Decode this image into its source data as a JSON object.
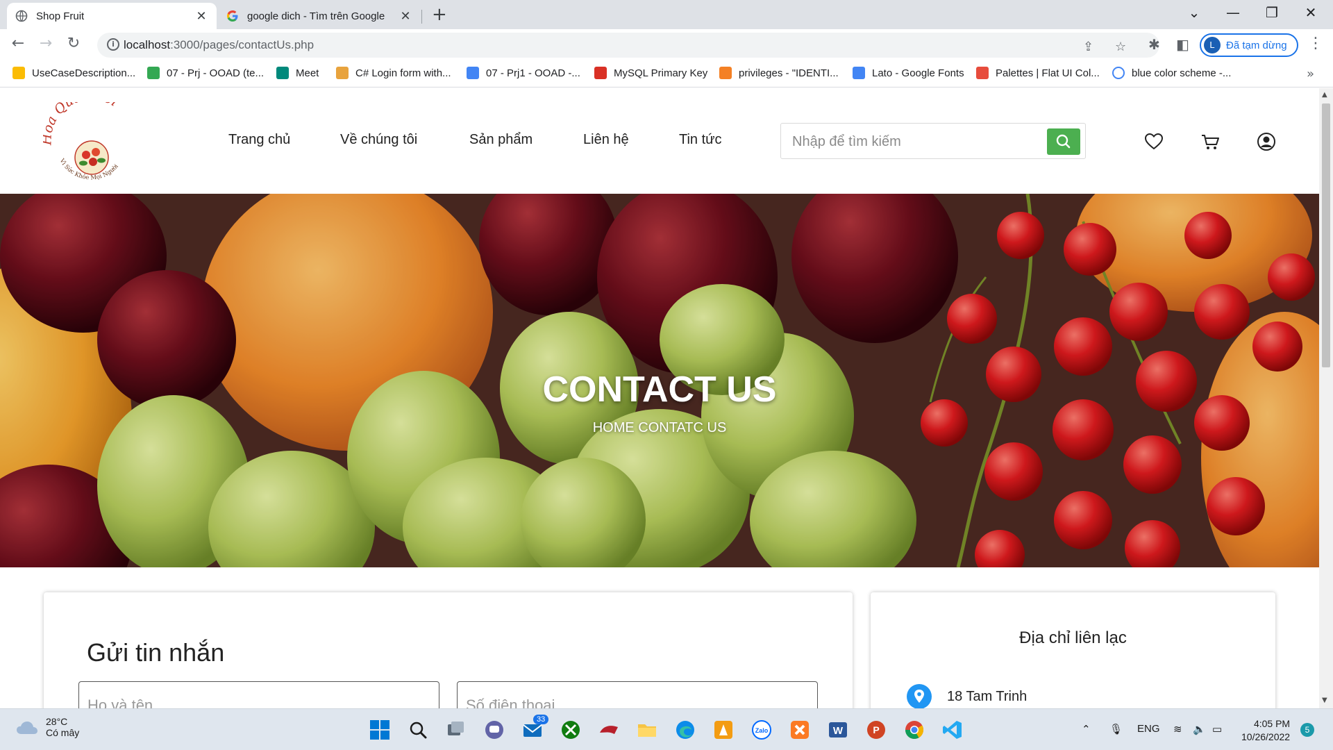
{
  "browser": {
    "tabs": [
      {
        "title": "Shop Fruit",
        "close": "✕"
      },
      {
        "title": "google dich - Tìm trên Google",
        "close": "✕"
      }
    ],
    "new_tab": "+",
    "address": {
      "host": "localhost",
      "path": ":3000/pages/contactUs.php"
    },
    "profile": {
      "initial": "L",
      "label": "Đã tạm dừng"
    },
    "bookmarks": [
      {
        "label": "UseCaseDescription...",
        "icon": "google-drive-icon",
        "color": "#fbbc04"
      },
      {
        "label": "07 - Prj - OOAD (te...",
        "icon": "google-drive-icon",
        "color": "#34a853"
      },
      {
        "label": "Meet",
        "icon": "google-meet-icon",
        "color": "#00897b"
      },
      {
        "label": "C# Login form with...",
        "icon": "page-icon",
        "color": "#e8a33d"
      },
      {
        "label": "07 - Prj1 - OOAD -...",
        "icon": "google-drive-icon",
        "color": "#4285f4"
      },
      {
        "label": "MySQL Primary Key",
        "icon": "mysql-icon",
        "color": "#d93025"
      },
      {
        "label": "privileges - \"IDENTI...",
        "icon": "stackoverflow-icon",
        "color": "#f48024"
      },
      {
        "label": "Lato - Google Fonts",
        "icon": "google-fonts-icon",
        "color": "#4285f4"
      },
      {
        "label": "Palettes | Flat UI Col...",
        "icon": "flatui-icon",
        "color": "#e74c3c"
      },
      {
        "label": "blue color scheme -...",
        "icon": "google-icon",
        "color": "#4285f4"
      }
    ],
    "bookmarks_more": "»"
  },
  "site": {
    "logo_alt": "Hoa Quả Tươi",
    "logo_line1": "Hoa Quả Tươi",
    "logo_line2": "Vì Sức Khỏe Mọi Người",
    "nav": [
      "Trang chủ",
      "Về chúng tôi",
      "Sản phẩm",
      "Liên hệ",
      "Tin tức"
    ],
    "search_placeholder": "Nhập để tìm kiếm",
    "icons": [
      "heart-icon",
      "cart-icon",
      "user-icon"
    ]
  },
  "hero": {
    "title": "CONTACT US",
    "breadcrumb": "HOME CONTATC US"
  },
  "message_card": {
    "title": "Gửi tin nhắn",
    "name_placeholder": "Họ và tên",
    "phone_placeholder": "Số điện thoại"
  },
  "address_card": {
    "title": "Địa chỉ liên lạc",
    "line1": "18 Tam Trinh"
  },
  "taskbar": {
    "weather_temp": "28°C",
    "weather_desc": "Có mây",
    "mail_badge": "33",
    "language": "ENG",
    "time": "4:05 PM",
    "date": "10/26/2022",
    "notifications": "5"
  },
  "colors": {
    "accent_green": "#4caf50",
    "chrome_blue": "#1a73e8",
    "pin_blue": "#2196f3"
  }
}
